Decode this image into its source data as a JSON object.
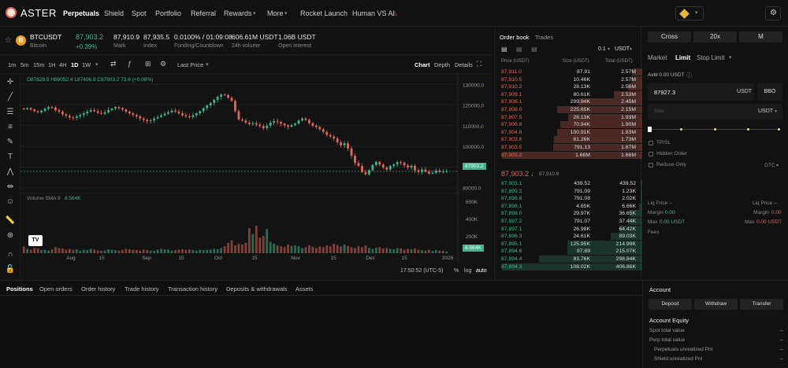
{
  "colors": {
    "up": "#3fb68b",
    "down": "#e0685a",
    "bg": "#0f0f0f",
    "accent": "#e9b43a"
  },
  "nav": {
    "logo": "ASTER",
    "items": [
      "Perpetuals",
      "Shield",
      "Spot",
      "Portfolio",
      "Referral",
      "Rewards",
      "More",
      "Rocket Launch",
      "Human VS AI"
    ],
    "icons": [
      "brand-logo-icon",
      "chevron-down-icon",
      "chevron-down-icon",
      "fire-icon",
      "wallet-icon",
      "chevron-down-icon",
      "settings-icon"
    ]
  },
  "ticker": {
    "symbol": "BTCUSDT",
    "name": "Bitcoin",
    "price": "87,903.2",
    "change": "+0.39%",
    "mark": "87,910.9",
    "mark_label": "Mark",
    "index": "87,935.5",
    "index_label": "Index",
    "funding": "0.0100% / 01:09:08",
    "funding_label": "Funding/Countdown",
    "volume": "606.61M USDT",
    "volume_label": "24h volume",
    "oi": "1.06B USDT",
    "oi_label": "Open interest"
  },
  "chart_toolbar": {
    "timeframes": [
      "1m",
      "5m",
      "15m",
      "1H",
      "4H",
      "1D",
      "1W"
    ],
    "price_mode": "Last Price",
    "views": [
      "Chart",
      "Depth",
      "Details"
    ]
  },
  "chart": {
    "ohlc": "O87829.5 H88052.4 L87406.9 C87903.2 73.6 (+0.08%)",
    "volume_label": "Volume SMA 9",
    "volume_value": "8.564K",
    "last_price_tag": "87903.2",
    "volume_tag": "8.564K",
    "time": "17:50:52 (UTC-5)",
    "pct": "%",
    "log": "log",
    "auto": "auto",
    "watermark": "TV"
  },
  "chart_data": {
    "type": "candlestick",
    "price_ticks": [
      "130000.0",
      "120000.0",
      "110000.0",
      "100000.0",
      "90000.0",
      "80000.0"
    ],
    "volume_ticks": [
      "600K",
      "400K",
      "200K"
    ],
    "x_ticks": [
      "Aug",
      "15",
      "Sep",
      "15",
      "Oct",
      "15",
      "Nov",
      "15",
      "Dec",
      "15",
      "2026"
    ],
    "closes": [
      118000,
      118500,
      117800,
      117000,
      116500,
      117200,
      118200,
      119000,
      118800,
      117500,
      116800,
      115500,
      114800,
      114000,
      113800,
      114500,
      115200,
      116000,
      116800,
      117500,
      117000,
      116200,
      115800,
      116500,
      117600,
      118300,
      119000,
      118500,
      117800,
      116800,
      116000,
      115200,
      114500,
      113500,
      112800,
      112200,
      112600,
      113500,
      114200,
      115000,
      115800,
      116500,
      117300,
      116800,
      116000,
      115000,
      114500,
      114200,
      115000,
      116000,
      117000,
      118500,
      119800,
      121000,
      122500,
      124000,
      125000,
      124800,
      123500,
      122000,
      117000,
      113000,
      112500,
      111500,
      110800,
      111200,
      110500,
      109800,
      108800,
      110000,
      111500,
      112200,
      111800,
      111000,
      110200,
      109500,
      110300,
      111000,
      112500,
      113500,
      112800,
      111200,
      110000,
      109300,
      108300,
      107000,
      105500,
      104800,
      103800,
      102000,
      100500,
      101500,
      99000,
      95500,
      92000,
      90500,
      87500,
      86500,
      88500,
      91000,
      92500,
      91200,
      89800,
      88800,
      90500,
      91200,
      92400,
      92000,
      90800,
      89800,
      90600,
      88400,
      87600,
      88800,
      87700,
      86800,
      87200,
      88300,
      87600,
      87900,
      87903
    ],
    "volumes": [
      80,
      50,
      40,
      60,
      55,
      35,
      40,
      30,
      45,
      70,
      60,
      55,
      40,
      50,
      38,
      45,
      30,
      40,
      36,
      50,
      40,
      30,
      28,
      32,
      45,
      40,
      35,
      30,
      38,
      50,
      45,
      40,
      38,
      30,
      42,
      35,
      30,
      28,
      40,
      50,
      45,
      42,
      30,
      35,
      40,
      45,
      38,
      44,
      36,
      30,
      40,
      35,
      38,
      42,
      50,
      45,
      60,
      80,
      120,
      150,
      90,
      110,
      100,
      120,
      290,
      220,
      320,
      180,
      200,
      280,
      130,
      110,
      90,
      80,
      70,
      100,
      85,
      90,
      80,
      60,
      70,
      90,
      75,
      60,
      80,
      70,
      90,
      80,
      110,
      95,
      80,
      100,
      85,
      70,
      60,
      80,
      70,
      90,
      60,
      50,
      65,
      70,
      55,
      60,
      50,
      45,
      60,
      55,
      40,
      50,
      45,
      55,
      40,
      35,
      30,
      40,
      25,
      35,
      30,
      28,
      20
    ]
  },
  "orderbook": {
    "tabs": [
      "Order book",
      "Trades"
    ],
    "step": "0.1",
    "unit": "USDT",
    "headers": [
      "Price (USDT)",
      "Size (USDT)",
      "Total (USDT)"
    ],
    "asks": [
      [
        "87,911.0",
        "87.91",
        "2.57M"
      ],
      [
        "87,910.5",
        "10.46K",
        "2.57M"
      ],
      [
        "87,910.2",
        "28.13K",
        "2.56M"
      ],
      [
        "87,909.1",
        "80.61K",
        "2.53M"
      ],
      [
        "87,908.1",
        "299.94K",
        "2.45M"
      ],
      [
        "87,908.0",
        "225.65K",
        "2.15M"
      ],
      [
        "87,907.5",
        "28.13K",
        "1.93M"
      ],
      [
        "87,906.8",
        "70.94K",
        "1.90M"
      ],
      [
        "87,904.8",
        "100.91K",
        "1.83M"
      ],
      [
        "87,903.6",
        "61.26K",
        "1.73M"
      ],
      [
        "87,903.5",
        "791.13",
        "1.67M"
      ],
      [
        "87,903.2",
        "1.66M",
        "1.66M"
      ]
    ],
    "ask_fill": [
      0.07,
      0.08,
      0.1,
      0.2,
      0.45,
      0.6,
      0.52,
      0.58,
      0.6,
      0.62,
      0.63,
      0.99
    ],
    "mid_price": "87,903.2",
    "mid_arrow": "↓",
    "mid_mark": "87,910.9",
    "bids": [
      [
        "87,903.1",
        "439.52",
        "439.52"
      ],
      [
        "87,899.2",
        "791.09",
        "1.23K"
      ],
      [
        "87,898.8",
        "791.08",
        "2.02K"
      ],
      [
        "87,898.1",
        "4.65K",
        "6.66K"
      ],
      [
        "87,898.0",
        "29.97K",
        "36.65K"
      ],
      [
        "87,897.2",
        "791.07",
        "37.44K"
      ],
      [
        "87,897.1",
        "26.98K",
        "64.42K"
      ],
      [
        "87,896.3",
        "24.61K",
        "89.03K"
      ],
      [
        "87,895.1",
        "125.95K",
        "214.99K"
      ],
      [
        "87,894.6",
        "87.89",
        "215.07K"
      ],
      [
        "87,894.4",
        "83.76K",
        "298.84K"
      ],
      [
        "87,894.3",
        "108.02K",
        "406.86K"
      ]
    ],
    "bid_fill": [
      0.01,
      0.01,
      0.01,
      0.02,
      0.09,
      0.1,
      0.16,
      0.22,
      0.53,
      0.53,
      0.73,
      0.99
    ]
  },
  "trade": {
    "margin_modes": [
      "Cross",
      "20x",
      "M"
    ],
    "order_types": [
      "Market",
      "Limit",
      "Stop Limit"
    ],
    "avbl": "Avbl 0.00 USDT",
    "price": "87927.3",
    "price_unit": "USDT",
    "bbo": "BBO",
    "size_placeholder": "Size",
    "size_unit": "USDT",
    "options": [
      "TP/SL",
      "Hidden Order",
      "Reduce-Only"
    ],
    "tif": "GTC",
    "liq_left": "Liq Price --",
    "liq_right": "Liq Price --",
    "margin_left": "Margin",
    "margin_left_v": "0.00",
    "margin_right": "Margin",
    "margin_right_v": "0.00",
    "max_left": "Max",
    "max_left_v": "0.00 USDT",
    "max_right": "Max",
    "max_right_v": "0.00 USDT",
    "fees": "Fees"
  },
  "bottom": {
    "tabs": [
      "Positions",
      "Open orders",
      "Order history",
      "Trade history",
      "Transaction history",
      "Deposits & withdrawals",
      "Assets"
    ]
  },
  "account": {
    "title": "Account",
    "buttons": [
      "Deposit",
      "Withdraw",
      "Transfer"
    ],
    "equity_title": "Account Equity",
    "rows": [
      [
        "Spot total value",
        "--"
      ],
      [
        "Perp total value",
        "--"
      ],
      [
        "Perpetuals unrealized Pnl",
        "--"
      ],
      [
        "Shield unrealized Pnl",
        "--"
      ]
    ]
  }
}
